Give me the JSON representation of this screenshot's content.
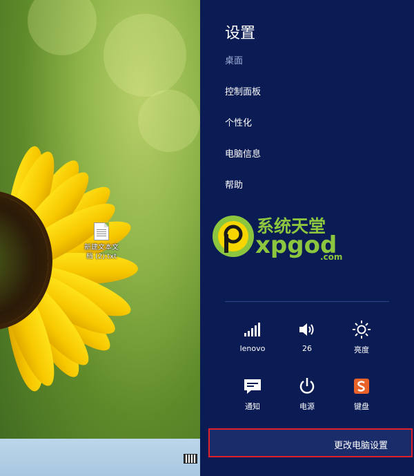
{
  "desktop": {
    "file_label_line1": "新建文本文",
    "file_label_line2": "档 (2).txt"
  },
  "settings": {
    "title": "设置",
    "context": "桌面",
    "menu": [
      "控制面板",
      "个性化",
      "电脑信息",
      "帮助"
    ],
    "tiles": [
      {
        "label": "lenovo",
        "icon": "wifi-signal-icon"
      },
      {
        "label": "26",
        "icon": "volume-icon"
      },
      {
        "label": "亮度",
        "icon": "brightness-icon"
      },
      {
        "label": "通知",
        "icon": "notification-icon"
      },
      {
        "label": "电源",
        "icon": "power-icon"
      },
      {
        "label": "键盘",
        "icon": "keyboard-ime-icon"
      }
    ],
    "change_settings": "更改电脑设置"
  },
  "watermark": {
    "cn": "系统天堂",
    "en": "xpgod",
    "domain": ".com"
  },
  "colors": {
    "panel_bg": "#0b1c55",
    "highlight_border": "#e0202a",
    "watermark_green": "#8cc63f"
  }
}
